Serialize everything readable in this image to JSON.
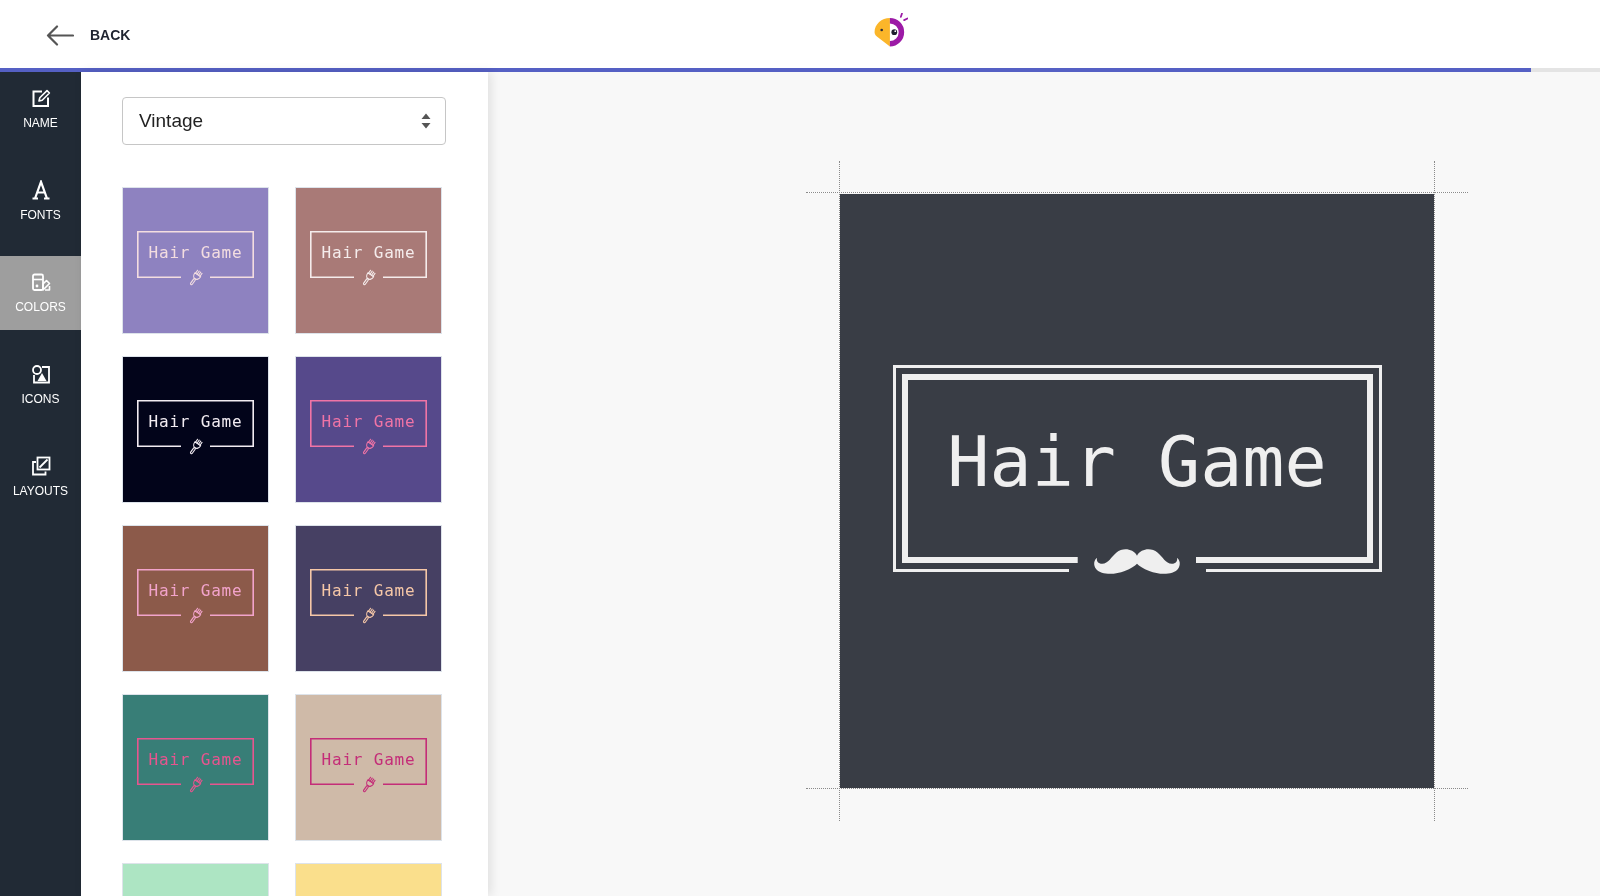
{
  "header": {
    "back_label": "BACK",
    "progress": {
      "level": 0.957
    }
  },
  "sidebar": {
    "items": [
      {
        "label": "NAME",
        "selected": false
      },
      {
        "label": "FONTS",
        "selected": false
      },
      {
        "label": "COLORS",
        "selected": true
      },
      {
        "label": "ICONS",
        "selected": false
      },
      {
        "label": "LAYOUTS",
        "selected": false
      }
    ]
  },
  "panel": {
    "style_select": {
      "value": "Vintage"
    },
    "tiles": [
      {
        "color": "#8e82c0",
        "logo": {
          "text": "Hair Game",
          "color": "#f3dde0"
        }
      },
      {
        "color": "#a97a77",
        "logo": {
          "text": "Hair Game",
          "color": "#f5ecec"
        }
      },
      {
        "color": "#02041a",
        "logo": {
          "text": "Hair Game",
          "color": "#f2ecf2"
        }
      },
      {
        "color": "#56498b",
        "logo": {
          "text": "Hair Game",
          "color": "#f074a6"
        }
      },
      {
        "color": "#8c5a4a",
        "logo": {
          "text": "Hair Game",
          "color": "#f2a3cb"
        }
      },
      {
        "color": "#464063",
        "logo": {
          "text": "Hair Game",
          "color": "#f6c7a7"
        }
      },
      {
        "color": "#387e77",
        "logo": {
          "text": "Hair Game",
          "color": "#e7558f"
        }
      },
      {
        "color": "#cfbaa8",
        "logo": {
          "text": "Hair Game",
          "color": "#c42d78"
        }
      },
      {
        "color": "#ade5c3"
      },
      {
        "color": "#fadf8c"
      }
    ]
  },
  "preview": {
    "logo_text": "Hair Game"
  }
}
